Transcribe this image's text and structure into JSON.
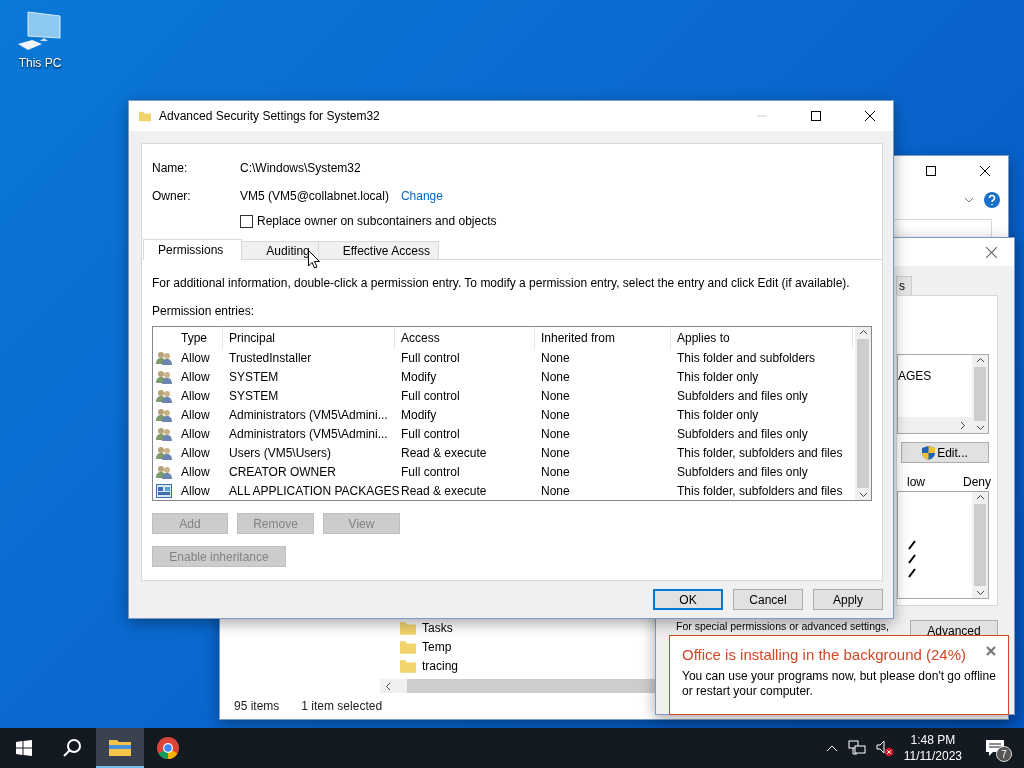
{
  "desktop_icons": [
    {
      "label": "This PC"
    }
  ],
  "explorer_window": {
    "files": [
      "Tasks",
      "Temp",
      "tracing"
    ],
    "status": [
      "95 items",
      "1 item selected"
    ]
  },
  "properties_window": {
    "tab": "s",
    "list_item": "AGES",
    "edit_button": "Edit...",
    "columns": [
      "low",
      "Deny"
    ],
    "note": "For special permissions or advanced settings,",
    "advanced_button": "Advanced"
  },
  "dialog": {
    "title": "Advanced Security Settings for System32",
    "fields": [
      {
        "label": "Name:",
        "value": "C:\\Windows\\System32"
      },
      {
        "label": "Owner:",
        "value": "VM5 (VM5@collabnet.local)",
        "link": "Change"
      }
    ],
    "replace_owner": {
      "label": "Replace owner on subcontainers and objects",
      "checked": false
    },
    "tabs": [
      {
        "label": "Permissions",
        "selected": true
      },
      {
        "label": "Auditing",
        "selected": false
      },
      {
        "label": "Effective Access",
        "selected": false
      }
    ],
    "info": "For additional information, double-click a permission entry. To modify a permission entry, select the entry and click Edit (if available).",
    "entries_label": "Permission entries:",
    "table": {
      "columns": [
        "Type",
        "Principal",
        "Access",
        "Inherited from",
        "Applies to"
      ],
      "rows": [
        {
          "kind": "group",
          "cells": [
            "Allow",
            "TrustedInstaller",
            "Full control",
            "None",
            "This folder and subfolders"
          ]
        },
        {
          "kind": "group",
          "cells": [
            "Allow",
            "SYSTEM",
            "Modify",
            "None",
            "This folder only"
          ]
        },
        {
          "kind": "group",
          "cells": [
            "Allow",
            "SYSTEM",
            "Full control",
            "None",
            "Subfolders and files only"
          ]
        },
        {
          "kind": "group",
          "cells": [
            "Allow",
            "Administrators (VM5\\Admini...",
            "Modify",
            "None",
            "This folder only"
          ]
        },
        {
          "kind": "group",
          "cells": [
            "Allow",
            "Administrators (VM5\\Admini...",
            "Full control",
            "None",
            "Subfolders and files only"
          ]
        },
        {
          "kind": "group",
          "cells": [
            "Allow",
            "Users (VM5\\Users)",
            "Read & execute",
            "None",
            "This folder, subfolders and files"
          ]
        },
        {
          "kind": "group",
          "cells": [
            "Allow",
            "CREATOR OWNER",
            "Full control",
            "None",
            "Subfolders and files only"
          ]
        },
        {
          "kind": "package",
          "cells": [
            "Allow",
            "ALL APPLICATION PACKAGES",
            "Read & execute",
            "None",
            "This folder, subfolders and files"
          ]
        }
      ]
    },
    "entry_buttons": [
      {
        "label": "Add",
        "disabled": true
      },
      {
        "label": "Remove",
        "disabled": true
      },
      {
        "label": "View",
        "disabled": true
      }
    ],
    "inheritance_button": {
      "label": "Enable inheritance",
      "disabled": true
    },
    "footer_buttons": [
      {
        "label": "OK",
        "default": true
      },
      {
        "label": "Cancel",
        "default": false
      },
      {
        "label": "Apply",
        "default": false
      }
    ]
  },
  "notification": {
    "title": "Office is installing in the background (24%)",
    "body": "You can use your programs now, but please don't go offline or restart your computer."
  },
  "taskbar": {
    "apps": [
      {
        "kind": "start",
        "active": false
      },
      {
        "kind": "search",
        "active": false
      },
      {
        "kind": "explorer",
        "active": true
      },
      {
        "kind": "browser",
        "active": false
      }
    ],
    "clock": {
      "time": "1:48 PM",
      "date": "11/11/2023"
    },
    "notification_count": "7"
  }
}
